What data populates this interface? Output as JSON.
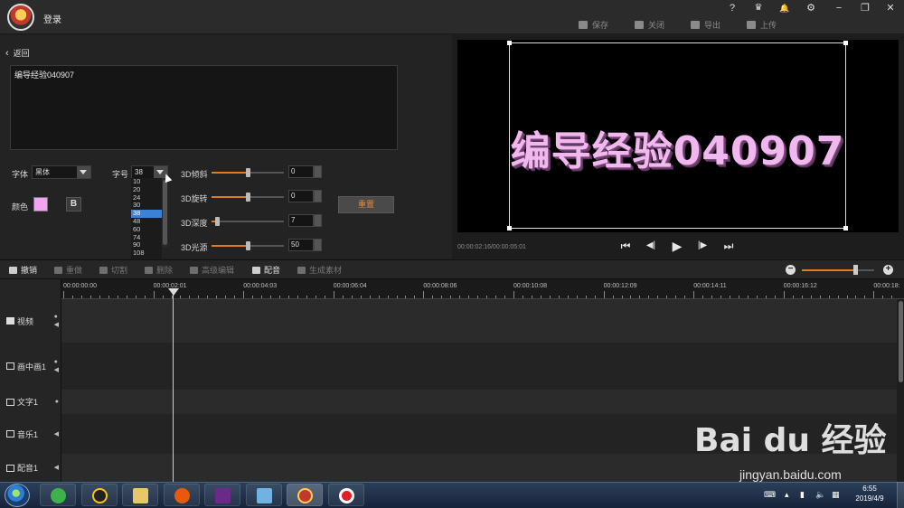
{
  "app": {
    "login_label": "登录",
    "actions": {
      "save": "保存",
      "close": "关闭",
      "export": "导出",
      "upload": "上传"
    },
    "window_icons": [
      "help-icon",
      "vip-icon",
      "bell-icon",
      "gear-icon",
      "minimize-icon",
      "restore-icon",
      "close-icon"
    ],
    "window_glyphs": {
      "help": "?",
      "vip": "♛",
      "bell": "🔔",
      "gear": "⚙",
      "minimize": "−",
      "restore": "❐",
      "close": "✕"
    }
  },
  "editor": {
    "back_label": "返回",
    "text_value": "编导经验040907",
    "font_label": "字体",
    "font_value": "黑体",
    "size_label": "字号",
    "size_value": "38",
    "size_options": [
      "10",
      "20",
      "24",
      "30",
      "38",
      "48",
      "60",
      "74",
      "90",
      "108"
    ],
    "size_selected": "38",
    "color_label": "颜色",
    "color_value": "#f4a3f0",
    "bold_label": "B",
    "sliders": [
      {
        "label": "3D倾斜",
        "value": "0",
        "level": 0.5
      },
      {
        "label": "3D旋转",
        "value": "0",
        "level": 0.5
      },
      {
        "label": "3D深度",
        "value": "7",
        "level": 0.07
      },
      {
        "label": "3D光源",
        "value": "50",
        "level": 0.5
      }
    ],
    "reset_label": "重置"
  },
  "preview": {
    "caption": "编导经验040907",
    "caption_color": "#f1b7ef",
    "timecode": "00:00:02:16/00:00:05:01",
    "controls": {
      "first": "⏮",
      "prev": "◀|",
      "play": "▶",
      "next": "|▶",
      "last": "⏭"
    }
  },
  "toolbar": {
    "undo": "撤销",
    "redo": "重做",
    "cut": "切割",
    "delete": "删除",
    "advanced": "高级编辑",
    "dub": "配音",
    "generate": "生成素材",
    "zoom_level": 0.75
  },
  "timeline": {
    "ticks": [
      "00:00:00:00",
      "00:00:02:01",
      "00:00:04:03",
      "00:00:06:04",
      "00:00:08:06",
      "00:00:10:08",
      "00:00:12:09",
      "00:00:14:11",
      "00:00:16:12",
      "00:00:18:"
    ],
    "tracks": [
      {
        "name": "视频",
        "icon": "play-icon"
      },
      {
        "name": "画中画1",
        "icon": "pip-icon"
      },
      {
        "name": "文字1",
        "icon": "text-icon"
      },
      {
        "name": "音乐1",
        "icon": "music-icon"
      },
      {
        "name": "配音1",
        "icon": "mic-icon"
      }
    ]
  },
  "watermark": {
    "brand": "Bai du 经验",
    "url": "jingyan.baidu.com"
  },
  "taskbar": {
    "clock_time": "6:55",
    "clock_date": "2019/4/9"
  }
}
